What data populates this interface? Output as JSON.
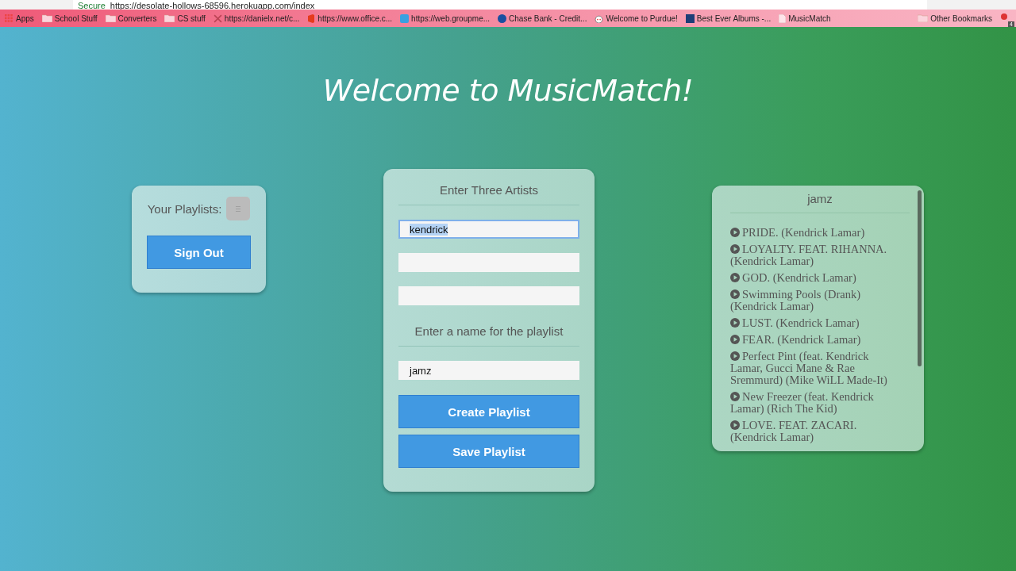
{
  "browser": {
    "security": "Secure",
    "url": "https://desolate-hollows-68596.herokuapp.com/index",
    "bookmarks": [
      {
        "label": "Apps",
        "kind": "apps"
      },
      {
        "label": "School Stuff",
        "kind": "folder"
      },
      {
        "label": "Converters",
        "kind": "folder"
      },
      {
        "label": "CS stuff",
        "kind": "folder"
      },
      {
        "label": "https://danielx.net/c...",
        "kind": "cross"
      },
      {
        "label": "https://www.office.c...",
        "kind": "office"
      },
      {
        "label": "https://web.groupme...",
        "kind": "chat"
      },
      {
        "label": "Chase Bank - Credit...",
        "kind": "bank"
      },
      {
        "label": "Welcome to Purdue!",
        "kind": "robot"
      },
      {
        "label": "Best Ever Albums -...",
        "kind": "bea"
      },
      {
        "label": "MusicMatch",
        "kind": "page"
      }
    ],
    "other_bookmarks": "Other Bookmarks",
    "extension_badge": "4"
  },
  "page": {
    "title": "Welcome to MusicMatch!"
  },
  "playlists_card": {
    "label": "Your Playlists:",
    "sign_out": "Sign Out"
  },
  "create_card": {
    "artists_heading": "Enter Three Artists",
    "artist_fields": [
      {
        "value": "kendrick",
        "focused": true
      },
      {
        "focused": false
      },
      {
        "focused": false
      }
    ],
    "name_heading": "Enter a name for the playlist",
    "name_value": "jamz",
    "buttons": [
      "Create Playlist",
      "Save Playlist"
    ]
  },
  "playlist": {
    "title": "jamz",
    "tracks": [
      "PRIDE. (Kendrick Lamar)",
      "LOYALTY. FEAT. RIHANNA. (Kendrick Lamar)",
      "GOD. (Kendrick Lamar)",
      "Swimming Pools (Drank) (Kendrick Lamar)",
      "LUST. (Kendrick Lamar)",
      "FEAR. (Kendrick Lamar)",
      "Perfect Pint (feat. Kendrick Lamar, Gucci Mane & Rae Sremmurd) (Mike WiLL Made-It)",
      "New Freezer (feat. Kendrick Lamar) (Rich The Kid)",
      "LOVE. FEAT. ZACARI. (Kendrick Lamar)"
    ]
  }
}
